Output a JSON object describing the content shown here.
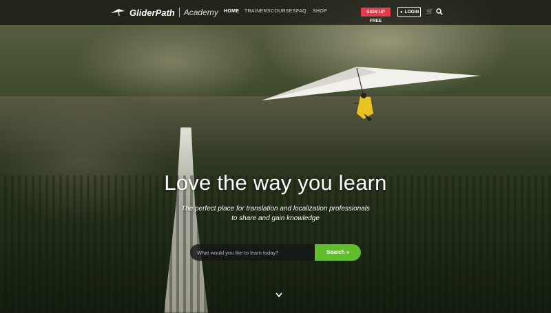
{
  "brand": {
    "name": "GliderPath",
    "sub": "Academy"
  },
  "nav": {
    "home": "HOME",
    "trainers": "TRAINERS",
    "courses": "COURSES",
    "faq": "FAQ",
    "shop": "SHOP"
  },
  "actions": {
    "signup": "SIGN UP FREE",
    "login": "LOGIN"
  },
  "icons": {
    "cart": "cart-icon",
    "search": "search-icon",
    "scroll": "chevron-down-icon",
    "user": "user-icon"
  },
  "hero": {
    "headline": "Love the way you learn",
    "subline1": "The perfect place for translation and localization professionals",
    "subline2": "to share and gain knowledge"
  },
  "search": {
    "placeholder": "What would you like to learn today?",
    "button": "Search »"
  },
  "colors": {
    "signup": "#e63b4a",
    "search_button": "#62bd2d",
    "topbar": "#000000"
  }
}
